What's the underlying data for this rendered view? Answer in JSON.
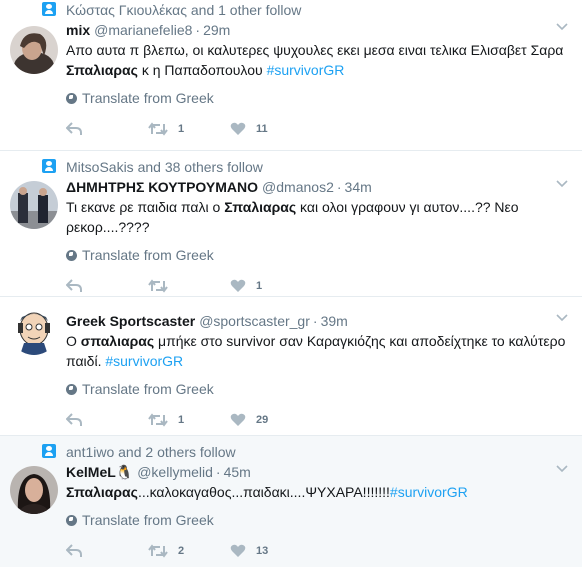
{
  "tweets": [
    {
      "context": "Κώστας Γκιουλέκας and 1 other follow",
      "name": "mix",
      "handle": "@marianefelie8",
      "time": "29m",
      "text_parts": [
        {
          "t": "Απο αυτα π βλεπω, οι καλυτερες ψυχουλες εκει μεσα ειναι τελικα Ελισαβετ Σαρα ",
          "style": "normal"
        },
        {
          "t": "Σπαλιαρας",
          "style": "bold"
        },
        {
          "t": " κ η Παπαδοπουλου ",
          "style": "normal"
        },
        {
          "t": "#survivorGR",
          "style": "hashtag"
        }
      ],
      "translate": "Translate from Greek",
      "reply_count": "",
      "retweet_count": "1",
      "like_count": "11"
    },
    {
      "context": "MitsoSakis and 38 others follow",
      "name": "ΔΗΜΗΤΡΗΣ ΚΟΥΤΡΟΥΜΑΝΟ",
      "handle": "@dmanos2",
      "time": "34m",
      "text_parts": [
        {
          "t": "Τι εκανε ρε παιδια παλι ο ",
          "style": "normal"
        },
        {
          "t": "Σπαλιαρας",
          "style": "bold"
        },
        {
          "t": " και ολοι γραφουν γι αυτον....?? Νεο ρεκορ....????",
          "style": "normal"
        }
      ],
      "translate": "Translate from Greek",
      "reply_count": "",
      "retweet_count": "",
      "like_count": "1"
    },
    {
      "context": "",
      "name": "Greek Sportscaster",
      "handle": "@sportscaster_gr",
      "time": "39m",
      "text_parts": [
        {
          "t": "Ο ",
          "style": "normal"
        },
        {
          "t": "σπαλιαρας",
          "style": "bold"
        },
        {
          "t": " μπήκε στο survivor σαν Καραγκιόζης και αποδείχτηκε το καλύτερο παιδί. ",
          "style": "normal"
        },
        {
          "t": "#survivorGR",
          "style": "hashtag"
        }
      ],
      "translate": "Translate from Greek",
      "reply_count": "",
      "retweet_count": "1",
      "like_count": "29"
    },
    {
      "context": "ant1iwo and 2 others follow",
      "name": "KelMeL🐧",
      "handle": "@kellymelid",
      "time": "45m",
      "text_parts": [
        {
          "t": "Σπαλιαρας",
          "style": "bold"
        },
        {
          "t": "...καλοκαγαθος...παιδακι....ΨΥΧΑΡΑ!!!!!!!",
          "style": "normal"
        },
        {
          "t": "#survivorGR",
          "style": "hashtag"
        }
      ],
      "translate": "Translate from Greek",
      "reply_count": "",
      "retweet_count": "2",
      "like_count": "13"
    }
  ]
}
